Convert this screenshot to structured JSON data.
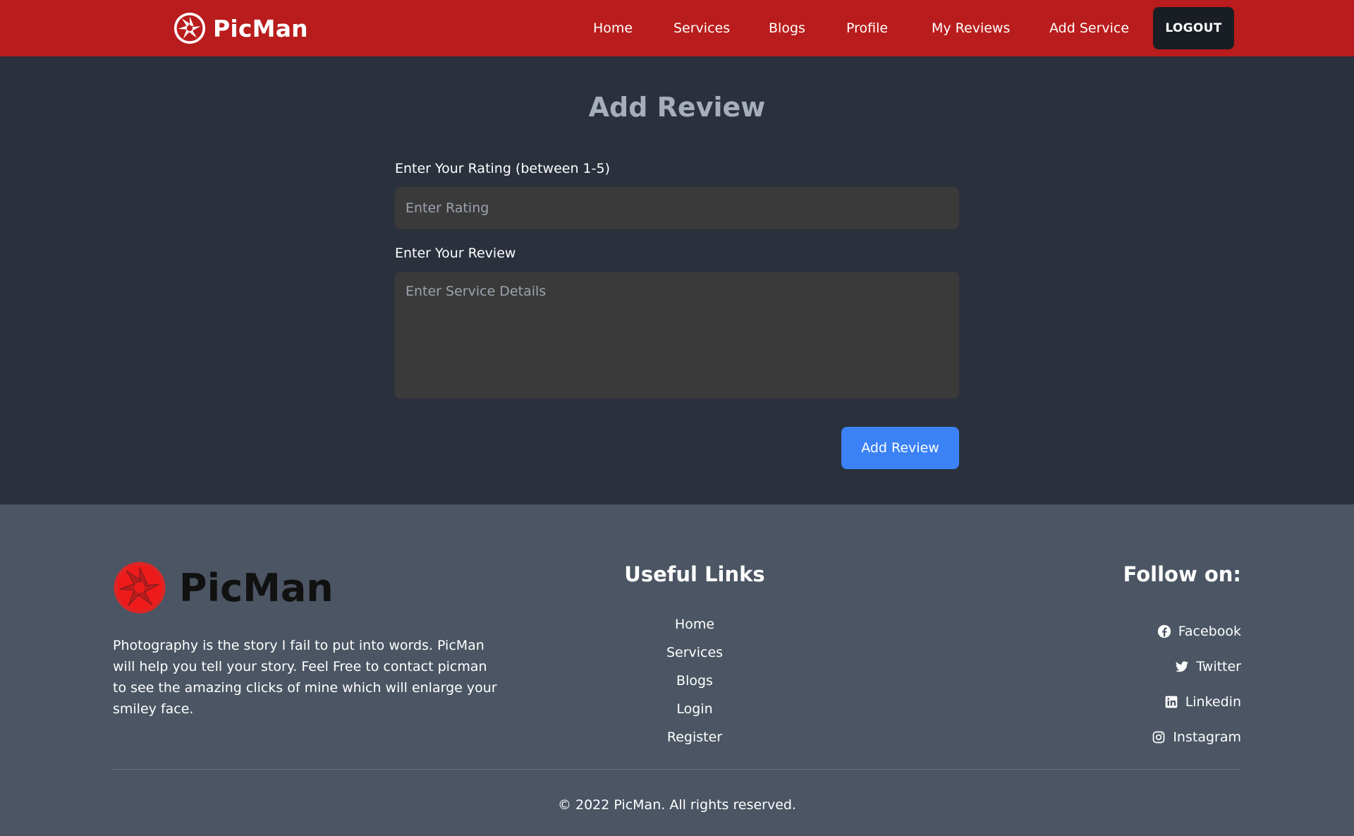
{
  "navbar": {
    "brand": "PicMan",
    "links": [
      "Home",
      "Services",
      "Blogs",
      "Profile",
      "My Reviews",
      "Add Service"
    ],
    "logout_label": "LOGOUT"
  },
  "main": {
    "title": "Add Review",
    "rating_label": "Enter Your Rating (between 1-5)",
    "rating_placeholder": "Enter Rating",
    "review_label": "Enter Your Review",
    "review_placeholder": "Enter Service Details",
    "submit_label": "Add Review"
  },
  "footer": {
    "brand": "PicMan",
    "description": "Photography is the story I fail to put into words. PicMan will help you tell your story. Feel Free to contact picman to see the amazing clicks of mine which will enlarge your smiley face.",
    "useful_links_heading": "Useful Links",
    "useful_links": [
      "Home",
      "Services",
      "Blogs",
      "Login",
      "Register"
    ],
    "follow_heading": "Follow on:",
    "social": [
      {
        "label": "Facebook",
        "icon": "facebook-icon"
      },
      {
        "label": "Twitter",
        "icon": "twitter-icon"
      },
      {
        "label": "Linkedin",
        "icon": "linkedin-icon"
      },
      {
        "label": "Instagram",
        "icon": "instagram-icon"
      }
    ],
    "copyright": "© 2022 PicMan. All rights reserved."
  },
  "colors": {
    "navbar": "#b91c1c",
    "main_bg": "#2a303c",
    "footer_bg": "#4b5563",
    "primary_button": "#3b82f6",
    "logout_button": "#191d24",
    "input_bg": "#3a3a3a"
  }
}
